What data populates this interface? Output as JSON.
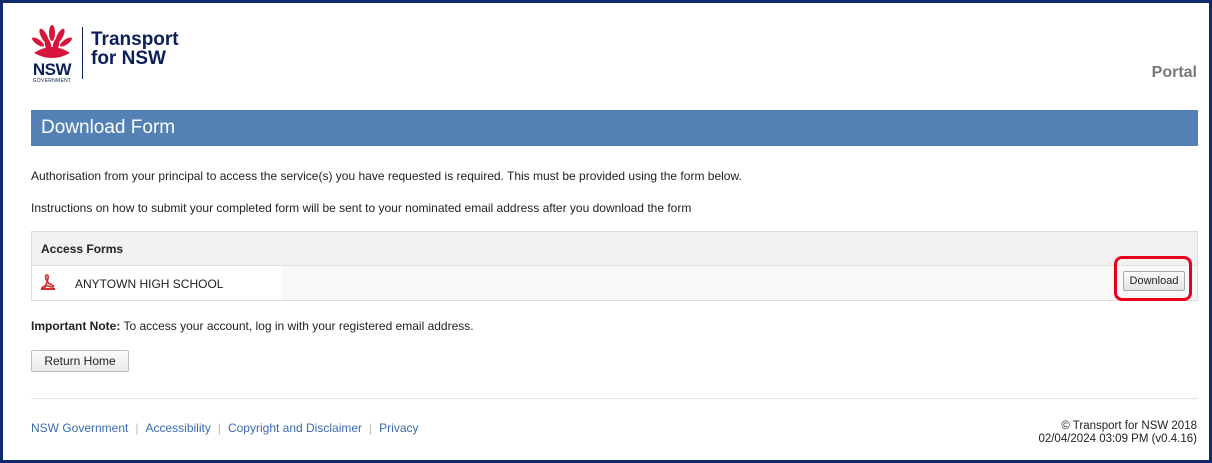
{
  "header": {
    "brand_short": "NSW",
    "brand_gov": "GOVERNMENT",
    "brand_line1": "Transport",
    "brand_line2": "for NSW",
    "portal_label": "Portal"
  },
  "page": {
    "title": "Download Form",
    "para1": "Authorisation from your principal to access the service(s) you have requested is required. This must be provided using the form below.",
    "para2": "Instructions on how to submit your completed form will be sent to your nominated email address after you download the form"
  },
  "forms": {
    "heading": "Access Forms",
    "rows": [
      {
        "icon": "pdf-icon",
        "label": "ANYTOWN HIGH SCHOOL",
        "action_label": "Download"
      }
    ]
  },
  "note": {
    "bold": "Important Note:",
    "text": " To access your account, log in with your registered email address."
  },
  "buttons": {
    "return_home": "Return Home"
  },
  "footer": {
    "links": [
      "NSW Government",
      "Accessibility",
      "Copyright and Disclaimer",
      "Privacy"
    ],
    "copyright": "© Transport for NSW 2018",
    "timestamp": "02/04/2024 03:09 PM (v0.4.16)"
  },
  "colors": {
    "title_bar": "#5481b4",
    "highlight": "#e8001c",
    "link": "#3a6ab0",
    "brand_navy": "#0c1f5a"
  }
}
